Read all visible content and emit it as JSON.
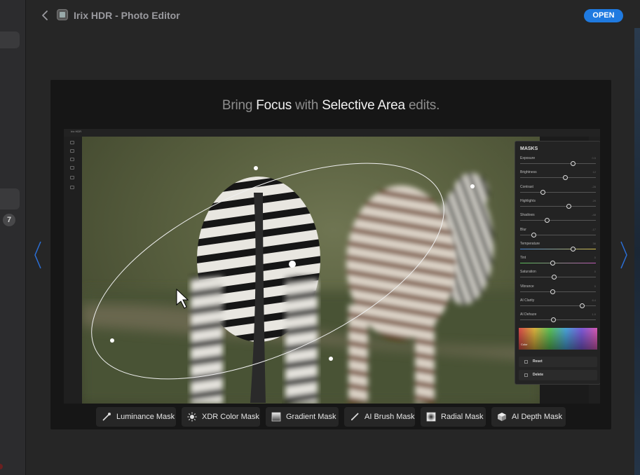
{
  "header": {
    "title": "Irix HDR - Photo Editor",
    "open_label": "OPEN"
  },
  "sidebar": {
    "badge_count": "7"
  },
  "headline": {
    "p1": "Bring ",
    "p2": "Focus",
    "p3": " with ",
    "p4": "Selective Area",
    "p5": " edits."
  },
  "editor": {
    "window_title": "Irix HDR",
    "panel_title": "MASKS",
    "sliders": [
      {
        "label": "Exposure",
        "value": "0.5",
        "level": 0.7
      },
      {
        "label": "Brightness",
        "value": "12",
        "level": 0.6
      },
      {
        "label": "Contrast",
        "value": "-28",
        "level": 0.3
      },
      {
        "label": "Highlights",
        "value": "29",
        "level": 0.64
      },
      {
        "label": "Shadows",
        "value": "-48",
        "level": 0.36
      },
      {
        "label": "Blur",
        "value": "-17",
        "level": 0.18
      },
      {
        "label": "Temperature",
        "value": "36",
        "level": 0.7
      },
      {
        "label": "Tint",
        "value": "0",
        "level": 0.43
      },
      {
        "label": "Saturation",
        "value": "0",
        "level": 0.45
      },
      {
        "label": "Vibrance",
        "value": "0",
        "level": 0.43
      },
      {
        "label": "AI Clarity",
        "value": "8.4",
        "level": 0.82
      },
      {
        "label": "AI Dehaze",
        "value": "1.0",
        "level": 0.44
      }
    ],
    "color_label": "Color",
    "reset_label": "Reset",
    "delete_label": "Delete"
  },
  "masks": [
    {
      "label": "Luminance Mask",
      "icon": "pipette-icon"
    },
    {
      "label": "XDR Color Mask",
      "icon": "sun-icon"
    },
    {
      "label": "Gradient Mask",
      "icon": "gradient-icon"
    },
    {
      "label": "AI Brush Mask",
      "icon": "brush-icon"
    },
    {
      "label": "Radial Mask",
      "icon": "radial-icon"
    },
    {
      "label": "AI Depth Mask",
      "icon": "cube-icon"
    }
  ],
  "colors": {
    "accent": "#1f7ae0",
    "background": "#262626",
    "card": "#161616"
  }
}
